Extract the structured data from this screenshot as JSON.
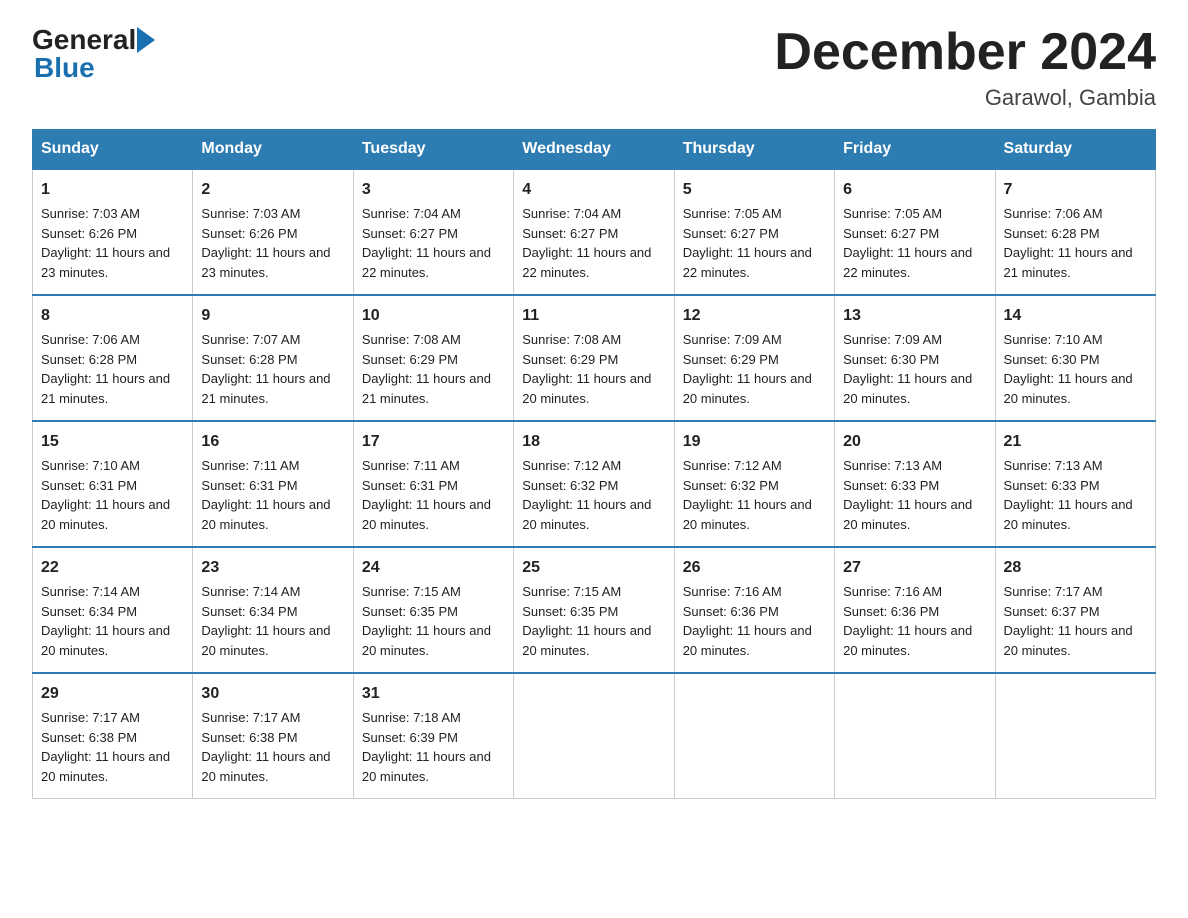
{
  "header": {
    "logo_general": "General",
    "logo_blue": "Blue",
    "main_title": "December 2024",
    "subtitle": "Garawol, Gambia"
  },
  "days_of_week": [
    "Sunday",
    "Monday",
    "Tuesday",
    "Wednesday",
    "Thursday",
    "Friday",
    "Saturday"
  ],
  "weeks": [
    [
      {
        "day": "1",
        "sunrise": "7:03 AM",
        "sunset": "6:26 PM",
        "daylight": "11 hours and 23 minutes."
      },
      {
        "day": "2",
        "sunrise": "7:03 AM",
        "sunset": "6:26 PM",
        "daylight": "11 hours and 23 minutes."
      },
      {
        "day": "3",
        "sunrise": "7:04 AM",
        "sunset": "6:27 PM",
        "daylight": "11 hours and 22 minutes."
      },
      {
        "day": "4",
        "sunrise": "7:04 AM",
        "sunset": "6:27 PM",
        "daylight": "11 hours and 22 minutes."
      },
      {
        "day": "5",
        "sunrise": "7:05 AM",
        "sunset": "6:27 PM",
        "daylight": "11 hours and 22 minutes."
      },
      {
        "day": "6",
        "sunrise": "7:05 AM",
        "sunset": "6:27 PM",
        "daylight": "11 hours and 22 minutes."
      },
      {
        "day": "7",
        "sunrise": "7:06 AM",
        "sunset": "6:28 PM",
        "daylight": "11 hours and 21 minutes."
      }
    ],
    [
      {
        "day": "8",
        "sunrise": "7:06 AM",
        "sunset": "6:28 PM",
        "daylight": "11 hours and 21 minutes."
      },
      {
        "day": "9",
        "sunrise": "7:07 AM",
        "sunset": "6:28 PM",
        "daylight": "11 hours and 21 minutes."
      },
      {
        "day": "10",
        "sunrise": "7:08 AM",
        "sunset": "6:29 PM",
        "daylight": "11 hours and 21 minutes."
      },
      {
        "day": "11",
        "sunrise": "7:08 AM",
        "sunset": "6:29 PM",
        "daylight": "11 hours and 20 minutes."
      },
      {
        "day": "12",
        "sunrise": "7:09 AM",
        "sunset": "6:29 PM",
        "daylight": "11 hours and 20 minutes."
      },
      {
        "day": "13",
        "sunrise": "7:09 AM",
        "sunset": "6:30 PM",
        "daylight": "11 hours and 20 minutes."
      },
      {
        "day": "14",
        "sunrise": "7:10 AM",
        "sunset": "6:30 PM",
        "daylight": "11 hours and 20 minutes."
      }
    ],
    [
      {
        "day": "15",
        "sunrise": "7:10 AM",
        "sunset": "6:31 PM",
        "daylight": "11 hours and 20 minutes."
      },
      {
        "day": "16",
        "sunrise": "7:11 AM",
        "sunset": "6:31 PM",
        "daylight": "11 hours and 20 minutes."
      },
      {
        "day": "17",
        "sunrise": "7:11 AM",
        "sunset": "6:31 PM",
        "daylight": "11 hours and 20 minutes."
      },
      {
        "day": "18",
        "sunrise": "7:12 AM",
        "sunset": "6:32 PM",
        "daylight": "11 hours and 20 minutes."
      },
      {
        "day": "19",
        "sunrise": "7:12 AM",
        "sunset": "6:32 PM",
        "daylight": "11 hours and 20 minutes."
      },
      {
        "day": "20",
        "sunrise": "7:13 AM",
        "sunset": "6:33 PM",
        "daylight": "11 hours and 20 minutes."
      },
      {
        "day": "21",
        "sunrise": "7:13 AM",
        "sunset": "6:33 PM",
        "daylight": "11 hours and 20 minutes."
      }
    ],
    [
      {
        "day": "22",
        "sunrise": "7:14 AM",
        "sunset": "6:34 PM",
        "daylight": "11 hours and 20 minutes."
      },
      {
        "day": "23",
        "sunrise": "7:14 AM",
        "sunset": "6:34 PM",
        "daylight": "11 hours and 20 minutes."
      },
      {
        "day": "24",
        "sunrise": "7:15 AM",
        "sunset": "6:35 PM",
        "daylight": "11 hours and 20 minutes."
      },
      {
        "day": "25",
        "sunrise": "7:15 AM",
        "sunset": "6:35 PM",
        "daylight": "11 hours and 20 minutes."
      },
      {
        "day": "26",
        "sunrise": "7:16 AM",
        "sunset": "6:36 PM",
        "daylight": "11 hours and 20 minutes."
      },
      {
        "day": "27",
        "sunrise": "7:16 AM",
        "sunset": "6:36 PM",
        "daylight": "11 hours and 20 minutes."
      },
      {
        "day": "28",
        "sunrise": "7:17 AM",
        "sunset": "6:37 PM",
        "daylight": "11 hours and 20 minutes."
      }
    ],
    [
      {
        "day": "29",
        "sunrise": "7:17 AM",
        "sunset": "6:38 PM",
        "daylight": "11 hours and 20 minutes."
      },
      {
        "day": "30",
        "sunrise": "7:17 AM",
        "sunset": "6:38 PM",
        "daylight": "11 hours and 20 minutes."
      },
      {
        "day": "31",
        "sunrise": "7:18 AM",
        "sunset": "6:39 PM",
        "daylight": "11 hours and 20 minutes."
      },
      null,
      null,
      null,
      null
    ]
  ]
}
